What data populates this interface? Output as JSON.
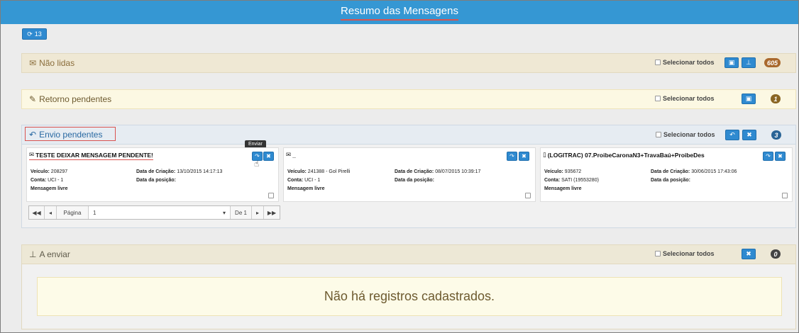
{
  "header": {
    "title": "Resumo das Mensagens"
  },
  "refresh_button": {
    "label": "13"
  },
  "sections": {
    "unread": {
      "title": "Não lidas",
      "select_all": "Selecionar todos",
      "count": "605",
      "badge_color": "#a9682d"
    },
    "return_pending": {
      "title": "Retorno pendentes",
      "select_all": "Selecionar todos",
      "count": "1",
      "badge_color": "#8a6523"
    },
    "send_pending": {
      "title": "Envio pendentes",
      "select_all": "Selecionar todos",
      "count": "3",
      "badge_color": "#2a6496",
      "tooltip": "Enviar",
      "cards": [
        {
          "title": "TESTE DEIXAR MENSAGEM PENDENTE!",
          "vehicle_label": "Veículo:",
          "vehicle": "208297",
          "account_label": "Conta:",
          "account": "UCI - 1",
          "type": "Mensagem livre",
          "created_label": "Data de Criação:",
          "created": "13/10/2015 14:17:13",
          "position_label": "Data da posição:"
        },
        {
          "title": "_",
          "vehicle_label": "Veículo:",
          "vehicle": "241388 - Gol Pirelli",
          "account_label": "Conta:",
          "account": "UCI - 1",
          "type": "Mensagem livre",
          "created_label": "Data de Criação:",
          "created": "08/07/2015 10:39:17",
          "position_label": "Data da posição:"
        },
        {
          "title": "(LOGITRAC) 07.ProibeCaronaN3+TravaBaú+ProibeDes",
          "vehicle_label": "Veículo:",
          "vehicle": "935672",
          "account_label": "Conta:",
          "account": "SATI (19553280)",
          "type": "Mensagem livre",
          "created_label": "Data de Criação:",
          "created": "30/06/2015 17:43:06",
          "position_label": "Data da posição:"
        }
      ],
      "pager": {
        "page_label": "Página",
        "page_value": "1",
        "of_label": "De 1"
      }
    },
    "to_send": {
      "title": "A enviar",
      "select_all": "Selecionar todos",
      "count": "0",
      "badge_color": "#444444",
      "empty_message": "Não há registros cadastrados."
    }
  }
}
